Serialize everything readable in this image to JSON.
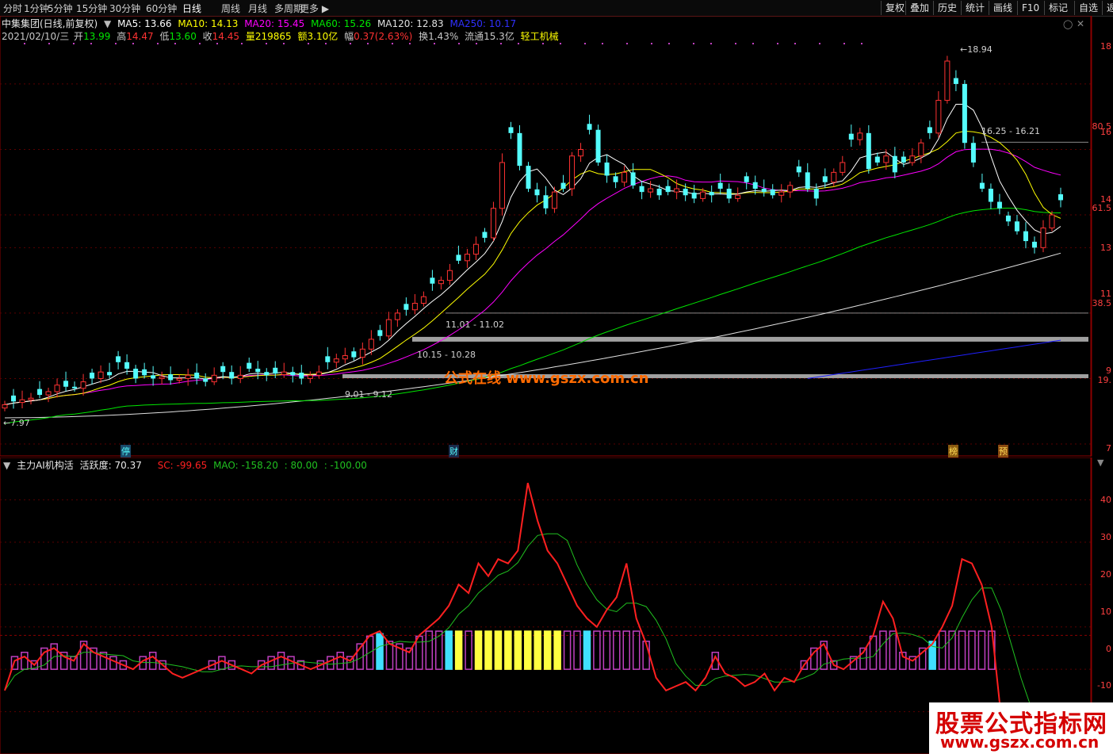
{
  "toolbar": {
    "tabs": [
      "分时",
      "1分钟",
      "5分钟",
      "15分钟",
      "30分钟",
      "60分钟",
      "日线",
      "周线",
      "月线",
      "多周期",
      "更多"
    ],
    "active": "日线",
    "right_tabs": [
      "复权",
      "叠加",
      "历史",
      "统计",
      "画线",
      "F10",
      "标记",
      "自选",
      "返"
    ]
  },
  "stock": {
    "name": "中集集团(日线,前复权)",
    "ma5": "MA5: 13.66",
    "ma10": "MA10: 14.13",
    "ma20": "MA20: 15.45",
    "ma60": "MA60: 15.26",
    "ma120": "MA120: 12.83",
    "ma250": "MA250: 10.17",
    "date": "2021/02/10/三",
    "open_l": "开",
    "open": "13.99",
    "high_l": "高",
    "high": "14.47",
    "low_l": "低",
    "low": "13.60",
    "close_l": "收",
    "close": "14.45",
    "vol": "量219865",
    "amt": "额3.10亿",
    "chg_l": "幅",
    "chg": "0.37(2.63%)",
    "turnover": "换1.43%",
    "float": "流通15.3亿",
    "sector": "轻工机械"
  },
  "colors": {
    "up": "#ff3232",
    "down": "#54fcfc",
    "ma5": "#ffffff",
    "ma10": "#ffff00",
    "ma20": "#ff00ff",
    "ma60": "#00e600",
    "ma120": "#e0e0e0",
    "ma250": "#2020ff",
    "sc": "#ff2020",
    "mao": "#20c020",
    "bar_yellow": "#ffff40",
    "bar_purple": "#c040c0",
    "bar_cyan": "#40e0ff",
    "watermark": "#ff6a00",
    "brand": "#d40000"
  },
  "chart_labels": {
    "low_price": "7.97",
    "high_price": "18.94",
    "range1": "9.01 - 9.12",
    "range2": "10.15 - 10.28",
    "range3": "11.01 - 11.02",
    "range4": "16.25 - 16.21",
    "mark_ting": "停",
    "mark_cai": "财",
    "mark_bang": "榜",
    "mark_yu": "预",
    "watermark": "公式在线  www.gszx.com.cn"
  },
  "price_axis": [
    "18",
    "80.5",
    "16",
    "14",
    "61.5",
    "13",
    "11",
    "38.5",
    "9",
    "19.",
    "7"
  ],
  "indicator": {
    "title": "主力AI机构活",
    "activity": "活跃度: 70.37",
    "sc": "SC: -99.65",
    "mao": "MAO: -158.20",
    "v1": ": 80.00",
    "v2": ": -100.00",
    "axis": [
      "40",
      "30",
      "20",
      "10",
      "0",
      "-10"
    ]
  },
  "brand": {
    "line1": "股票公式指标网",
    "line2": "www.gszx.com.cn"
  },
  "chart_data": {
    "type": "candlestick",
    "candles_note": "daily candles, prices",
    "closes": [
      8.2,
      8.3,
      8.35,
      8.4,
      8.5,
      8.6,
      8.8,
      8.75,
      8.7,
      8.9,
      9.0,
      9.2,
      9.1,
      9.5,
      9.3,
      9.0,
      9.1,
      9.0,
      9.05,
      8.95,
      9.0,
      9.1,
      9.0,
      8.9,
      9.1,
      9.2,
      9.0,
      9.1,
      9.3,
      9.2,
      9.1,
      9.15,
      9.2,
      9.1,
      9.0,
      9.1,
      9.2,
      9.5,
      9.6,
      9.7,
      9.65,
      9.9,
      10.2,
      10.3,
      10.8,
      11.0,
      11.1,
      11.3,
      11.5,
      11.9,
      12.0,
      12.3,
      12.6,
      12.8,
      13.1,
      13.3,
      14.2,
      15.6,
      16.5,
      15.5,
      14.8,
      14.6,
      14.2,
      14.7,
      14.8,
      15.8,
      16.0,
      16.6,
      15.6,
      15.2,
      15.0,
      15.3,
      14.9,
      14.7,
      14.8,
      14.6,
      14.7,
      14.8,
      14.6,
      14.5,
      14.7,
      14.6,
      14.8,
      14.5,
      14.6,
      15.0,
      14.8,
      14.7,
      14.6,
      14.7,
      14.9,
      15.3,
      14.8,
      14.5,
      15.0,
      15.3,
      15.6,
      16.3,
      16.5,
      15.4,
      15.6,
      15.8,
      15.3,
      15.6,
      15.8,
      16.2,
      16.5,
      17.5,
      18.7,
      18.0,
      16.2,
      15.6,
      14.8,
      14.4,
      14.2,
      13.8,
      13.5,
      13.2,
      13.0,
      13.6,
      14.0,
      14.45
    ],
    "ma120_end": 12.83,
    "ma250_end": 10.17,
    "indicator_sc": [
      -5,
      2,
      3,
      1,
      4,
      5,
      3,
      2,
      6,
      4,
      3,
      2,
      1,
      0,
      2,
      3,
      1,
      -1,
      -2,
      -1,
      0,
      1,
      2,
      1,
      0,
      -1,
      1,
      2,
      3,
      2,
      1,
      0,
      1,
      2,
      3,
      2,
      5,
      8,
      9,
      6,
      5,
      4,
      8,
      10,
      12,
      15,
      20,
      18,
      25,
      22,
      26,
      25,
      28,
      44,
      35,
      28,
      25,
      20,
      15,
      12,
      10,
      14,
      17,
      25,
      12,
      6,
      -2,
      -5,
      -4,
      -3,
      -5,
      -2,
      3,
      -1,
      -2,
      -4,
      -3,
      -1,
      -5,
      -2,
      -3,
      1,
      4,
      6,
      1,
      0,
      2,
      4,
      8,
      16,
      12,
      3,
      2,
      4,
      6,
      10,
      15,
      26,
      25,
      20,
      10,
      -12,
      -14,
      -15,
      -14,
      -13,
      -12,
      -10
    ]
  }
}
